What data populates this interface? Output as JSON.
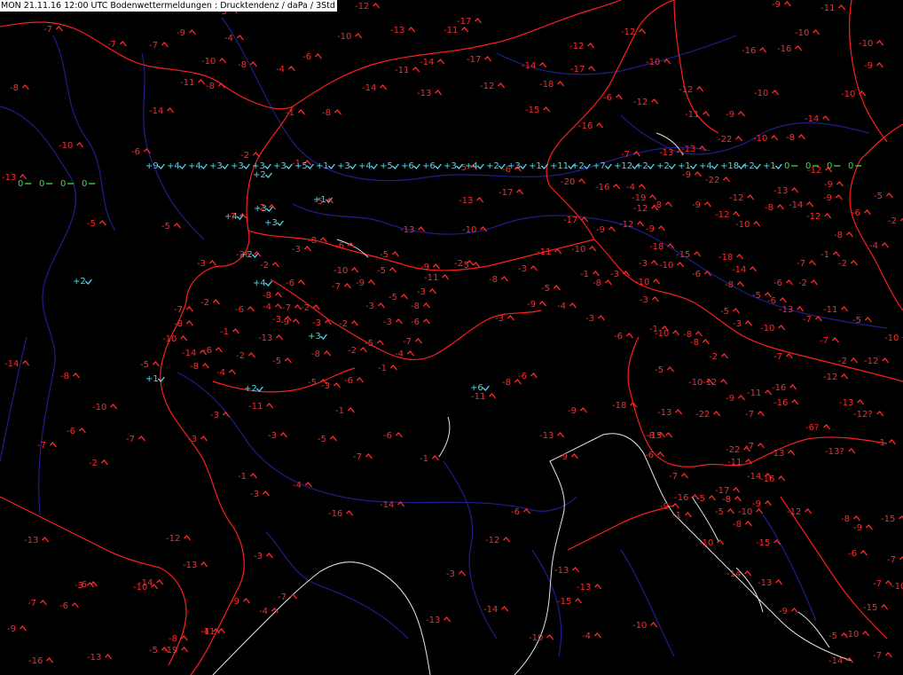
{
  "header": {
    "title": "MON 21.11.16 12:00 UTC  Bodenwettermeldungen :  Drucktendenz / daPa / 3Std"
  },
  "colors": {
    "background": "#000000",
    "falling": "#ff2a2a",
    "rising": "#4fd8f0",
    "steady": "#3ee040",
    "borders": "#ff1e1e",
    "rivers": "#1e1e8c",
    "coast": "#e6e6e6",
    "header_bg": "#ffffff",
    "header_text": "#000000"
  },
  "observations": [
    {
      "v": "-5",
      "t": "fall"
    },
    {
      "v": "-7",
      "t": "fall"
    },
    {
      "v": "-9",
      "t": "fall"
    },
    {
      "v": "-4",
      "t": "fall"
    },
    {
      "v": "-7",
      "t": "fall"
    },
    {
      "v": "-7",
      "t": "fall"
    },
    {
      "v": "-6",
      "t": "fall"
    },
    {
      "v": "-10",
      "t": "fall"
    },
    {
      "v": "-8",
      "t": "fall"
    },
    {
      "v": "-4",
      "t": "fall"
    },
    {
      "v": "-11",
      "t": "fall"
    },
    {
      "v": "-8",
      "t": "fall"
    },
    {
      "v": "-8",
      "t": "fall"
    },
    {
      "v": "-14",
      "t": "fall"
    },
    {
      "v": "-10",
      "t": "fall"
    },
    {
      "v": "-6",
      "t": "fall"
    },
    {
      "v": "-13",
      "t": "fall"
    },
    {
      "v": "-5",
      "t": "fall"
    },
    {
      "v": "-1",
      "t": "fall"
    },
    {
      "v": "-8",
      "t": "fall"
    },
    {
      "v": "-2",
      "t": "fall"
    },
    {
      "v": "-1",
      "t": "fall"
    },
    {
      "v": "+2",
      "t": "rise"
    },
    {
      "v": "+3",
      "t": "rise"
    },
    {
      "v": "+3",
      "t": "rise"
    },
    {
      "v": "+4",
      "t": "rise"
    },
    {
      "v": "+2",
      "t": "rise"
    },
    {
      "v": "+1",
      "t": "rise"
    },
    {
      "v": "-12",
      "t": "fall"
    },
    {
      "v": "-10",
      "t": "fall"
    },
    {
      "v": "-13",
      "t": "fall"
    },
    {
      "v": "-11",
      "t": "fall"
    },
    {
      "v": "-17",
      "t": "fall"
    },
    {
      "v": "-14",
      "t": "fall"
    },
    {
      "v": "-17",
      "t": "fall"
    },
    {
      "v": "-11",
      "t": "fall"
    },
    {
      "v": "-14",
      "t": "fall"
    },
    {
      "v": "-13",
      "t": "fall"
    },
    {
      "v": "-12",
      "t": "fall"
    },
    {
      "v": "-14",
      "t": "fall"
    },
    {
      "v": "-18",
      "t": "fall"
    },
    {
      "v": "-15",
      "t": "fall"
    },
    {
      "v": "-12",
      "t": "fall"
    },
    {
      "v": "-17",
      "t": "fall"
    },
    {
      "v": "-12",
      "t": "fall"
    },
    {
      "v": "-10",
      "t": "fall"
    },
    {
      "v": "-12",
      "t": "fall"
    },
    {
      "v": "-10",
      "t": "fall"
    },
    {
      "v": "-6",
      "t": "fall"
    },
    {
      "v": "-12",
      "t": "fall"
    },
    {
      "v": "-11",
      "t": "fall"
    },
    {
      "v": "-16",
      "t": "fall"
    },
    {
      "v": "-9",
      "t": "fall"
    },
    {
      "v": "-10",
      "t": "fall"
    },
    {
      "v": "-8",
      "t": "fall"
    },
    {
      "v": "-14",
      "t": "fall"
    },
    {
      "v": "-16",
      "t": "fall"
    },
    {
      "v": "-16",
      "t": "fall"
    },
    {
      "v": "-9",
      "t": "fall"
    },
    {
      "v": "-10",
      "t": "fall"
    },
    {
      "v": "-11",
      "t": "fall"
    },
    {
      "v": "-10",
      "t": "fall"
    },
    {
      "v": "-9",
      "t": "fall"
    },
    {
      "v": "-10",
      "t": "fall"
    },
    {
      "v": "-5",
      "t": "fall"
    },
    {
      "v": "-6",
      "t": "fall"
    },
    {
      "v": "-13",
      "t": "fall"
    },
    {
      "v": "-17",
      "t": "fall"
    },
    {
      "v": "-13",
      "t": "fall"
    },
    {
      "v": "-10",
      "t": "fall"
    },
    {
      "v": "-20",
      "t": "fall"
    },
    {
      "v": "-16",
      "t": "fall"
    },
    {
      "v": "-4",
      "t": "fall"
    },
    {
      "v": "-17",
      "t": "fall"
    },
    {
      "v": "-9",
      "t": "fall"
    },
    {
      "v": "-12",
      "t": "fall"
    },
    {
      "v": "-9",
      "t": "fall"
    },
    {
      "v": "-10",
      "t": "fall"
    },
    {
      "v": "-11",
      "t": "fall"
    },
    {
      "v": "-12",
      "t": "fall"
    },
    {
      "v": "-8",
      "t": "fall"
    },
    {
      "v": "-9",
      "t": "fall"
    },
    {
      "v": "-12",
      "t": "fall"
    },
    {
      "v": "-12",
      "t": "fall"
    },
    {
      "v": "-10",
      "t": "fall"
    },
    {
      "v": "-8",
      "t": "fall"
    },
    {
      "v": "-14",
      "t": "fall"
    },
    {
      "v": "-12",
      "t": "fall"
    },
    {
      "v": "-9",
      "t": "fall"
    },
    {
      "v": "-9",
      "t": "fall"
    },
    {
      "v": "-13",
      "t": "fall"
    },
    {
      "v": "-12",
      "t": "fall"
    },
    {
      "v": "-13",
      "t": "fall"
    },
    {
      "v": "-13",
      "t": "fall"
    },
    {
      "v": "-7",
      "t": "fall"
    },
    {
      "v": "-22",
      "t": "fall"
    },
    {
      "v": "-9",
      "t": "fall"
    },
    {
      "v": "-22",
      "t": "fall"
    },
    {
      "v": "-19",
      "t": "fall"
    },
    {
      "v": "-18",
      "t": "fall"
    },
    {
      "v": "-15",
      "t": "fall"
    },
    {
      "v": "-18",
      "t": "fall"
    },
    {
      "v": "-14",
      "t": "fall"
    },
    {
      "v": "-10",
      "t": "fall"
    },
    {
      "v": "-10",
      "t": "fall"
    },
    {
      "v": "-8",
      "t": "fall"
    },
    {
      "v": "-3",
      "t": "fall"
    },
    {
      "v": "-10",
      "t": "fall"
    },
    {
      "v": "-8",
      "t": "fall"
    },
    {
      "v": "-2",
      "t": "fall"
    },
    {
      "v": "-10",
      "t": "fall"
    },
    {
      "v": "-7",
      "t": "fall"
    },
    {
      "v": "-13",
      "t": "fall"
    },
    {
      "v": "-7",
      "t": "fall"
    },
    {
      "v": "-11",
      "t": "fall"
    },
    {
      "v": "-7",
      "t": "fall"
    },
    {
      "v": "-5",
      "t": "fall"
    },
    {
      "v": "-2",
      "t": "fall"
    },
    {
      "v": "-12",
      "t": "fall"
    },
    {
      "v": "-10",
      "t": "fall"
    },
    {
      "v": "-12",
      "t": "fall"
    },
    {
      "v": "-13",
      "t": "fall"
    },
    {
      "v": "-12?",
      "t": "fall"
    },
    {
      "v": "-6?",
      "t": "fall"
    },
    {
      "v": "-13?",
      "t": "fall"
    },
    {
      "v": "-1",
      "t": "fall"
    },
    {
      "v": "-13",
      "t": "fall"
    },
    {
      "v": "-7",
      "t": "fall"
    },
    {
      "v": "-16",
      "t": "fall"
    },
    {
      "v": "-7",
      "t": "fall"
    },
    {
      "v": "-22",
      "t": "fall"
    },
    {
      "v": "-16",
      "t": "fall"
    },
    {
      "v": "-9",
      "t": "fall"
    },
    {
      "v": "-7",
      "t": "fall"
    },
    {
      "v": "-14",
      "t": "fall"
    },
    {
      "v": "-5",
      "t": "fall"
    },
    {
      "v": "-10",
      "t": "fall"
    },
    {
      "v": "-10",
      "t": "fall"
    },
    {
      "v": "-15",
      "t": "fall"
    },
    {
      "v": "-12",
      "t": "fall"
    },
    {
      "v": "-8",
      "t": "fall"
    },
    {
      "v": "-15",
      "t": "fall"
    },
    {
      "v": "-7",
      "t": "fall"
    },
    {
      "v": "-10",
      "t": "fall"
    },
    {
      "v": "-15",
      "t": "fall"
    },
    {
      "v": "-10",
      "t": "fall"
    },
    {
      "v": "-14",
      "t": "fall"
    },
    {
      "v": "-7",
      "t": "fall"
    },
    {
      "v": "-9",
      "t": "fall"
    },
    {
      "v": "-7",
      "t": "fall"
    },
    {
      "v": "-13",
      "t": "fall"
    },
    {
      "v": "-7",
      "t": "fall"
    },
    {
      "v": "-14",
      "t": "fall"
    },
    {
      "v": "-6",
      "t": "fall"
    },
    {
      "v": "-14",
      "t": "fall"
    },
    {
      "v": "-12",
      "t": "fall"
    },
    {
      "v": "-11",
      "t": "fall"
    },
    {
      "v": "-19",
      "t": "fall"
    },
    {
      "v": "-13",
      "t": "fall"
    },
    {
      "v": "-16",
      "t": "fall"
    },
    {
      "v": "-16",
      "t": "fall"
    },
    {
      "v": "-14",
      "t": "fall"
    },
    {
      "v": "-6",
      "t": "fall"
    },
    {
      "v": "-12",
      "t": "fall"
    },
    {
      "v": "-13",
      "t": "fall"
    },
    {
      "v": "-14",
      "t": "fall"
    },
    {
      "v": "-10",
      "t": "fall"
    },
    {
      "v": "-10",
      "t": "fall"
    },
    {
      "v": "-13",
      "t": "fall"
    },
    {
      "v": "-13",
      "t": "fall"
    },
    {
      "v": "-15",
      "t": "fall"
    },
    {
      "v": "-13",
      "t": "fall"
    },
    {
      "v": "-9",
      "t": "fall"
    },
    {
      "v": "-6",
      "t": "fall"
    },
    {
      "v": "-15",
      "t": "fall"
    },
    {
      "v": "-13",
      "t": "fall"
    },
    {
      "v": "-10",
      "t": "fall"
    },
    {
      "v": "-12",
      "t": "fall"
    },
    {
      "v": "-9",
      "t": "fall"
    },
    {
      "v": "-11",
      "t": "fall"
    },
    {
      "v": "-16",
      "t": "fall"
    },
    {
      "v": "-22",
      "t": "fall"
    },
    {
      "v": "-5",
      "t": "fall"
    },
    {
      "v": "-17",
      "t": "fall"
    },
    {
      "v": "-11",
      "t": "fall"
    },
    {
      "v": "-16",
      "t": "fall"
    },
    {
      "v": "-9",
      "t": "fall"
    },
    {
      "v": "-8",
      "t": "fall"
    },
    {
      "v": "-14",
      "t": "fall"
    },
    {
      "v": "-13",
      "t": "fall"
    },
    {
      "v": "-9",
      "t": "fall"
    },
    {
      "v": "-5",
      "t": "fall"
    },
    {
      "v": "-7",
      "t": "fall"
    },
    {
      "v": "-6",
      "t": "fall"
    },
    {
      "v": "-9",
      "t": "fall"
    },
    {
      "v": "-3",
      "t": "fall"
    },
    {
      "v": "-8",
      "t": "fall"
    },
    {
      "v": "-6",
      "t": "fall"
    },
    {
      "v": "-5",
      "t": "fall"
    },
    {
      "v": "-9",
      "t": "fall"
    },
    {
      "v": "-2",
      "t": "fall"
    },
    {
      "v": "-8",
      "t": "fall"
    },
    {
      "v": "-3",
      "t": "fall"
    },
    {
      "v": "-5",
      "t": "fall"
    },
    {
      "v": "-1",
      "t": "fall"
    },
    {
      "v": "-3",
      "t": "fall"
    },
    {
      "v": "-3",
      "t": "fall"
    },
    {
      "v": "-4",
      "t": "fall"
    },
    {
      "v": "-3",
      "t": "fall"
    },
    {
      "v": "-6",
      "t": "fall"
    },
    {
      "v": "-1",
      "t": "fall"
    },
    {
      "v": "-8",
      "t": "fall"
    },
    {
      "v": "-5",
      "t": "fall"
    },
    {
      "v": "-3",
      "t": "fall"
    },
    {
      "v": "-6",
      "t": "fall"
    },
    {
      "v": "-2",
      "t": "fall"
    },
    {
      "v": "-1",
      "t": "fall"
    },
    {
      "v": "-2",
      "t": "fall"
    },
    {
      "v": "-4",
      "t": "fall"
    },
    {
      "v": "-2",
      "t": "fall"
    },
    {
      "v": "-5",
      "t": "fall"
    },
    {
      "v": "-6",
      "t": "fall"
    },
    {
      "v": "-8",
      "t": "fall"
    },
    {
      "v": "-7",
      "t": "fall"
    },
    {
      "v": "-6",
      "t": "fall"
    },
    {
      "v": "-5",
      "t": "fall"
    },
    {
      "v": "-8",
      "t": "fall"
    },
    {
      "v": "-6",
      "t": "fall"
    },
    {
      "v": "-10",
      "t": "fall"
    },
    {
      "v": "-9",
      "t": "fall"
    },
    {
      "v": "-7",
      "t": "fall"
    },
    {
      "v": "-6",
      "t": "fall"
    },
    {
      "v": "-8",
      "t": "fall"
    },
    {
      "v": "-2",
      "t": "fall"
    },
    {
      "v": "-3",
      "t": "fall"
    },
    {
      "v": "-3",
      "t": "fall"
    },
    {
      "v": "-2",
      "t": "fall"
    },
    {
      "v": "-3",
      "t": "fall"
    },
    {
      "v": "-3",
      "t": "fall"
    },
    {
      "v": "-8",
      "t": "fall"
    },
    {
      "v": "-3",
      "t": "fall"
    },
    {
      "v": "-11",
      "t": "fall"
    },
    {
      "v": "-5",
      "t": "fall"
    },
    {
      "v": "-6",
      "t": "fall"
    },
    {
      "v": "-7",
      "t": "fall"
    },
    {
      "v": "-4",
      "t": "fall"
    },
    {
      "v": "-1",
      "t": "fall"
    },
    {
      "v": "-5",
      "t": "fall"
    },
    {
      "v": "-2",
      "t": "fall"
    },
    {
      "v": "-8",
      "t": "fall"
    },
    {
      "v": "-5",
      "t": "fall"
    },
    {
      "v": "-5",
      "t": "fall"
    },
    {
      "v": "-6",
      "t": "fall"
    },
    {
      "v": "-3",
      "t": "fall"
    },
    {
      "v": "-1",
      "t": "fall"
    },
    {
      "v": "-5",
      "t": "fall"
    },
    {
      "v": "-3",
      "t": "fall"
    },
    {
      "v": "-3",
      "t": "fall"
    },
    {
      "v": "-1",
      "t": "fall"
    },
    {
      "v": "-3",
      "t": "fall"
    },
    {
      "v": "-4",
      "t": "fall"
    },
    {
      "v": "-7",
      "t": "fall"
    },
    {
      "v": "-6",
      "t": "fall"
    },
    {
      "v": "-1",
      "t": "fall"
    },
    {
      "v": "-11",
      "t": "fall"
    },
    {
      "v": "-8",
      "t": "fall"
    },
    {
      "v": "-3",
      "t": "fall"
    },
    {
      "v": "-9",
      "t": "fall"
    },
    {
      "v": "-9",
      "t": "fall"
    },
    {
      "v": "-18",
      "t": "fall"
    },
    {
      "v": "-8",
      "t": "fall"
    },
    {
      "v": "-1",
      "t": "fall"
    },
    {
      "v": "-5",
      "t": "fall"
    },
    {
      "v": "-8",
      "t": "fall"
    },
    {
      "v": "-13",
      "t": "fall"
    },
    {
      "v": "-10",
      "t": "fall"
    },
    {
      "v": "-5",
      "t": "fall"
    },
    {
      "v": "-3",
      "t": "fall"
    },
    {
      "v": "-6",
      "t": "fall"
    },
    {
      "v": "-8",
      "t": "fall"
    },
    {
      "v": "-9",
      "t": "fall"
    },
    {
      "v": "-4",
      "t": "fall"
    },
    {
      "v": "-5",
      "t": "fall"
    },
    {
      "v": "-7",
      "t": "fall"
    },
    {
      "v": "-2",
      "t": "fall"
    },
    {
      "v": "-5",
      "t": "fall"
    },
    {
      "v": "-26",
      "t": "fall"
    },
    {
      "v": "-5",
      "t": "fall"
    },
    {
      "v": "-5",
      "t": "fall"
    },
    {
      "v": "-7",
      "t": "fall"
    },
    {
      "v": "-2",
      "t": "fall"
    },
    {
      "v": "-8",
      "t": "fall"
    },
    {
      "v": "-6",
      "t": "fall"
    },
    {
      "v": "-4",
      "t": "fall"
    },
    {
      "v": "-9",
      "t": "fall"
    },
    {
      "v": "-7",
      "t": "fall"
    },
    {
      "v": "-1",
      "t": "fall"
    },
    {
      "v": "-13",
      "t": "fall"
    },
    {
      "v": "-10",
      "t": "fall"
    },
    {
      "v": "-14",
      "t": "fall"
    },
    {
      "v": "-6",
      "t": "fall"
    },
    {
      "v": "-5",
      "t": "fall"
    },
    {
      "v": "-8",
      "t": "fall"
    },
    {
      "v": "-2",
      "t": "fall"
    },
    {
      "v": "-4",
      "t": "fall"
    },
    {
      "v": "-8",
      "t": "fall"
    },
    {
      "v": "-10",
      "t": "fall"
    },
    {
      "v": "-11",
      "t": "fall"
    },
    {
      "v": "-3",
      "t": "fall"
    },
    {
      "v": "-7",
      "t": "fall"
    },
    {
      "v": "-2",
      "t": "fall"
    },
    {
      "v": "-6",
      "t": "fall"
    },
    {
      "v": "-6",
      "t": "fall"
    },
    {
      "v": "-3",
      "t": "fall"
    },
    {
      "v": "-7",
      "t": "fall"
    },
    {
      "v": "-4",
      "t": "fall"
    },
    {
      "v": "-3",
      "t": "fall"
    },
    {
      "v": "-4",
      "t": "fall"
    },
    {
      "v": "-3",
      "t": "fall"
    },
    {
      "v": "-2",
      "t": "fall"
    },
    {
      "v": "+2",
      "t": "rise"
    },
    {
      "v": "+4",
      "t": "rise"
    },
    {
      "v": "+3",
      "t": "rise"
    },
    {
      "v": "+1",
      "t": "rise"
    },
    {
      "v": "+2",
      "t": "rise"
    },
    {
      "v": "+6",
      "t": "rise"
    },
    {
      "v": "+9",
      "t": "rise"
    },
    {
      "v": "+4",
      "t": "rise"
    },
    {
      "v": "+4",
      "t": "rise"
    },
    {
      "v": "+3",
      "t": "rise"
    },
    {
      "v": "+3",
      "t": "rise"
    },
    {
      "v": "+3",
      "t": "rise"
    },
    {
      "v": "+3",
      "t": "rise"
    },
    {
      "v": "+5",
      "t": "rise"
    },
    {
      "v": "+1",
      "t": "rise"
    },
    {
      "v": "+3",
      "t": "rise"
    },
    {
      "v": "+4",
      "t": "rise"
    },
    {
      "v": "+5",
      "t": "rise"
    },
    {
      "v": "+6",
      "t": "rise"
    },
    {
      "v": "+6",
      "t": "rise"
    },
    {
      "v": "+3",
      "t": "rise"
    },
    {
      "v": "+4",
      "t": "rise"
    },
    {
      "v": "+2",
      "t": "rise"
    },
    {
      "v": "+3",
      "t": "rise"
    },
    {
      "v": "+1",
      "t": "rise"
    },
    {
      "v": "+11",
      "t": "rise"
    },
    {
      "v": "+2",
      "t": "rise"
    },
    {
      "v": "+7",
      "t": "rise"
    },
    {
      "v": "+12",
      "t": "rise"
    },
    {
      "v": "+2",
      "t": "rise"
    },
    {
      "v": "+2",
      "t": "rise"
    },
    {
      "v": "+1",
      "t": "rise"
    },
    {
      "v": "+4",
      "t": "rise"
    },
    {
      "v": "+18",
      "t": "rise"
    },
    {
      "v": "+2",
      "t": "rise"
    },
    {
      "v": "+1",
      "t": "rise"
    },
    {
      "v": "0",
      "t": "steady"
    },
    {
      "v": "0",
      "t": "steady"
    },
    {
      "v": "0",
      "t": "steady"
    },
    {
      "v": "0",
      "t": "steady"
    },
    {
      "v": "0",
      "t": "steady"
    },
    {
      "v": "0",
      "t": "steady"
    },
    {
      "v": "0",
      "t": "steady"
    },
    {
      "v": "0",
      "t": "steady"
    }
  ]
}
